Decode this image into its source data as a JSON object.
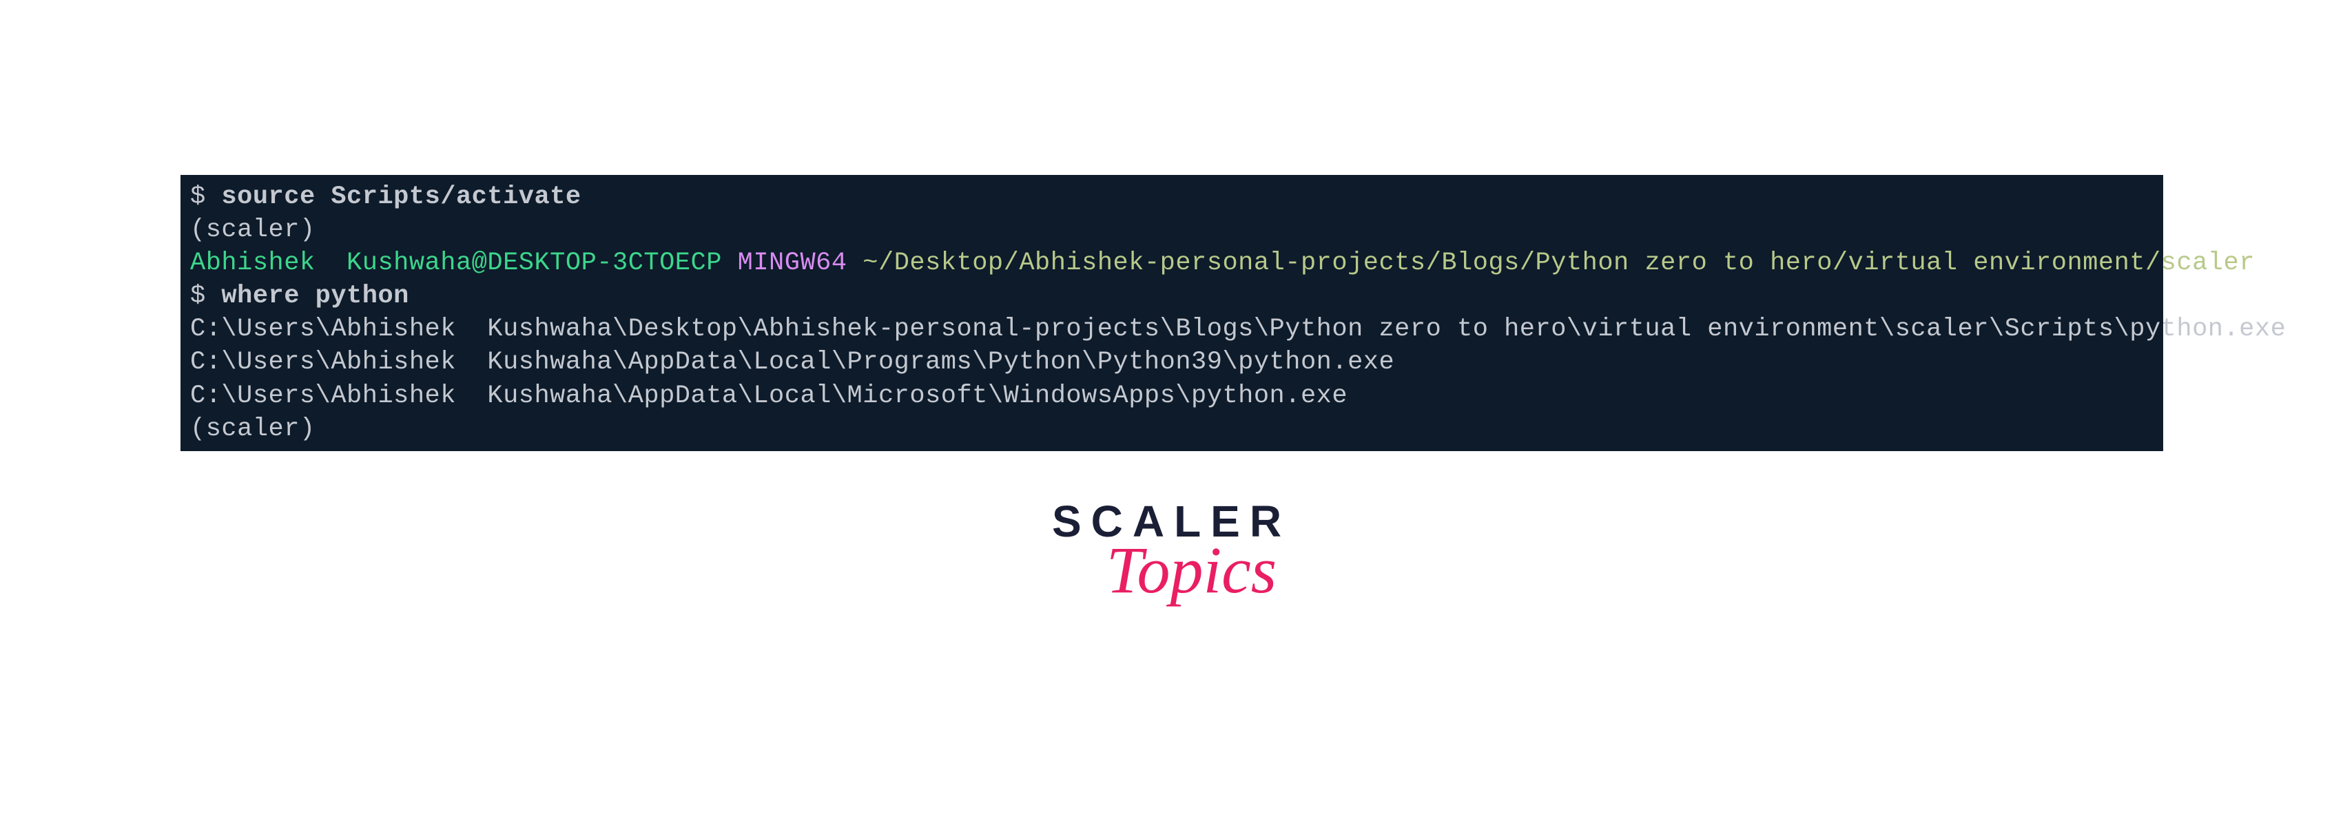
{
  "terminal": {
    "line1_prompt": "$ ",
    "line1_cmd": "source Scripts/activate",
    "line2_env": "(scaler)",
    "line3_userhost": "Abhishek  Kushwaha@DESKTOP-3CTOECP",
    "line3_mingw": " MINGW64",
    "line3_path": " ~/Desktop/Abhishek-personal-projects/Blogs/Python zero to hero/virtual environment/scaler",
    "line4_prompt": "$ ",
    "line4_cmd": "where python",
    "line5_out": "C:\\Users\\Abhishek  Kushwaha\\Desktop\\Abhishek-personal-projects\\Blogs\\Python zero to hero\\virtual environment\\scaler\\Scripts\\python.exe",
    "line6_out": "C:\\Users\\Abhishek  Kushwaha\\AppData\\Local\\Programs\\Python\\Python39\\python.exe",
    "line7_out": "C:\\Users\\Abhishek  Kushwaha\\AppData\\Local\\Microsoft\\WindowsApps\\python.exe",
    "line8_env": "(scaler)"
  },
  "logo": {
    "scaler": "SCALER",
    "topics": "Topics"
  }
}
